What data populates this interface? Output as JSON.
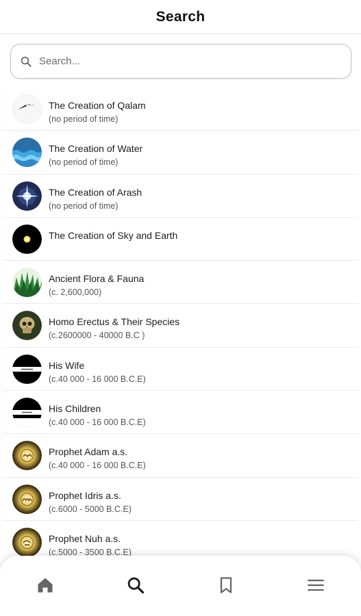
{
  "header": {
    "title": "Search"
  },
  "search": {
    "placeholder": "Search..."
  },
  "items": [
    {
      "title": "The Creation of Qalam",
      "subtitle": "(no period of time)",
      "icon": "qalam-icon"
    },
    {
      "title": "The Creation of Water",
      "subtitle": "(no period of time)",
      "icon": "water-icon"
    },
    {
      "title": "The Creation of Arash",
      "subtitle": "(no period of time)",
      "icon": "arash-star-icon"
    },
    {
      "title": "The Creation of Sky and Earth",
      "subtitle": "",
      "icon": "sky-earth-icon"
    },
    {
      "title": "Ancient Flora & Fauna",
      "subtitle": "(c. 2,600,000)",
      "icon": "flora-icon"
    },
    {
      "title": "Homo Erectus & Their Species",
      "subtitle": "(c.2600000 - 40000 B.C )",
      "icon": "skull-icon"
    },
    {
      "title": "His Wife",
      "subtitle": "(c.40 000 - 16 000 B.C.E)",
      "icon": "wife-icon"
    },
    {
      "title": "His Children",
      "subtitle": "(c.40 000 - 16 000 B.C.E)",
      "icon": "children-icon"
    },
    {
      "title": "Prophet Adam a.s.",
      "subtitle": "(c.40 000 - 16 000 B.C.E)",
      "icon": "adam-calligraphy-icon"
    },
    {
      "title": "Prophet Idris a.s.",
      "subtitle": " (c.6000 - 5000 B.C.E)",
      "icon": "idris-calligraphy-icon"
    },
    {
      "title": "Prophet Nuh a.s.",
      "subtitle": "(c.5000 - 3500 B.C.E)",
      "icon": "nuh-calligraphy-icon"
    }
  ],
  "nav": [
    {
      "name": "home",
      "icon": "home-icon"
    },
    {
      "name": "search",
      "icon": "search-icon"
    },
    {
      "name": "bookmarks",
      "icon": "bookmark-icon"
    },
    {
      "name": "menu",
      "icon": "menu-icon"
    }
  ]
}
